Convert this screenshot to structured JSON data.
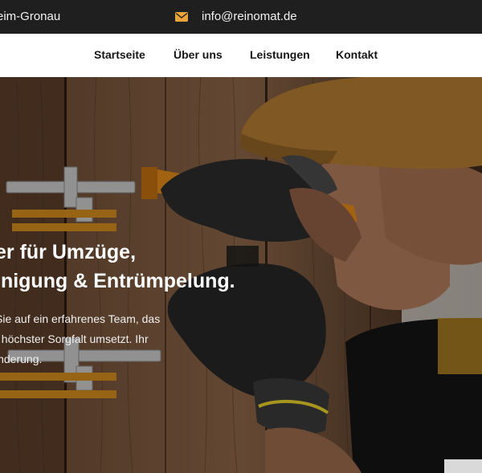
{
  "topbar": {
    "address": "eim-Gronau",
    "email": "info@reinomat.de",
    "accent_color": "#e8a33a",
    "email_icon": "envelope-icon"
  },
  "nav": {
    "items": [
      {
        "label": "Startseite"
      },
      {
        "label": "Über uns"
      },
      {
        "label": "Leistungen"
      },
      {
        "label": "Kontakt"
      }
    ]
  },
  "hero": {
    "headline_line1": "er für Umzüge,",
    "headline_line2": "inigung & Entrümpelung.",
    "intro_line1": "Sie auf ein erfahrenes Team, das",
    "intro_line2": "t höchster Sorgfalt umsetzt. Ihr",
    "intro_line3": "inderung."
  }
}
